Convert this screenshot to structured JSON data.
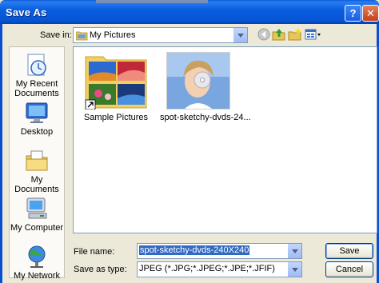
{
  "window": {
    "title": "Save As",
    "help_label": "?",
    "close_label": "✕"
  },
  "save_in": {
    "label": "Save in:",
    "value": "My Pictures"
  },
  "toolbar": {
    "icons": [
      "back-icon",
      "up-folder-icon",
      "new-folder-icon",
      "views-menu-icon"
    ]
  },
  "places": [
    {
      "label": "My Recent Documents",
      "icon": "recent-documents-icon"
    },
    {
      "label": "Desktop",
      "icon": "desktop-icon"
    },
    {
      "label": "My Documents",
      "icon": "my-documents-icon"
    },
    {
      "label": "My Computer",
      "icon": "my-computer-icon"
    },
    {
      "label": "My Network",
      "icon": "my-network-icon"
    }
  ],
  "files": [
    {
      "name": "Sample Pictures",
      "type": "folder-shortcut"
    },
    {
      "name": "spot-sketchy-dvds-24...",
      "type": "jpeg-thumbnail"
    }
  ],
  "file_name": {
    "label": "File name:",
    "value": "spot-sketchy-dvds-240X240"
  },
  "save_as_type": {
    "label": "Save as type:",
    "value": "JPEG (*.JPG;*.JPEG;*.JPE;*.JFIF)"
  },
  "buttons": {
    "save": "Save",
    "cancel": "Cancel"
  },
  "colors": {
    "titlebar": "#0a5ee0",
    "selection": "#316ac5",
    "dialog_face": "#ece9d8"
  }
}
